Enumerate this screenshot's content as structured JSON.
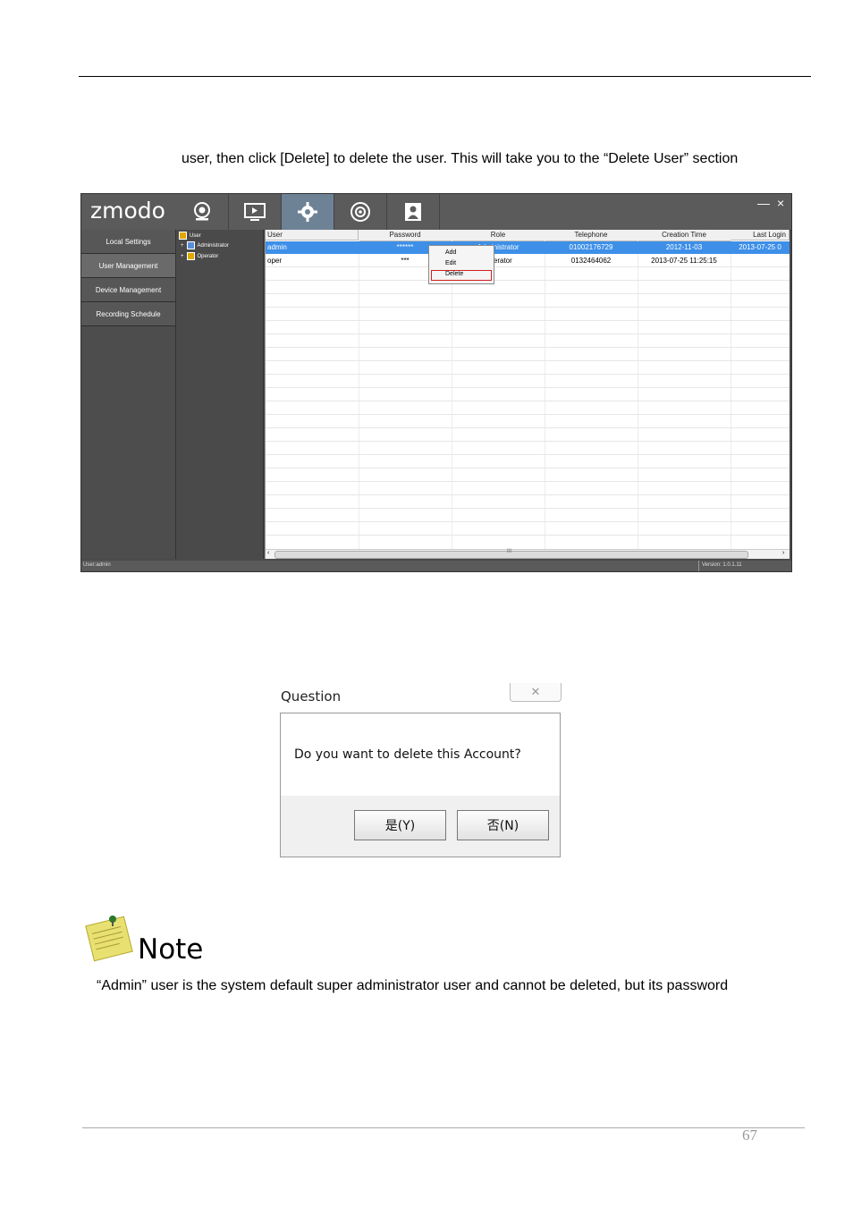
{
  "intro_text": "user, then click [Delete] to delete the user. This will take you to the “Delete User” section",
  "app": {
    "logo": "zmodo",
    "toolbar_icons": [
      "camera-icon",
      "playback-monitor-icon",
      "settings-gear-icon",
      "ptz-icon",
      "user-account-icon"
    ],
    "sidebar_items": [
      {
        "label": "Local Settings"
      },
      {
        "label": "User Management"
      },
      {
        "label": "Device Management"
      },
      {
        "label": "Recording Schedule"
      }
    ],
    "tree": {
      "root": "User",
      "children": [
        "Administrator",
        "Operator"
      ]
    },
    "table": {
      "columns": [
        "User",
        "Password",
        "Role",
        "Telephone",
        "Creation Time",
        "Last Login"
      ],
      "rows": [
        [
          "admin",
          "******",
          "Administrator",
          "01002176729",
          "2012-11-03",
          "2013-07-25 0"
        ],
        [
          "oper",
          "***",
          "Operator",
          "0132464062",
          "2013-07-25 11:25:15",
          ""
        ]
      ]
    },
    "context_menu": [
      "Add",
      "Edit",
      "Delete"
    ],
    "status_left": "User:admin",
    "status_right": "Version: 1.0.1.11",
    "window_controls": {
      "minimize": "—",
      "close": "×"
    },
    "scroll_mark": "III"
  },
  "dialog": {
    "title": "Question",
    "close_glyph": "✕",
    "message": "Do you want to delete this Account?",
    "yes_label": "是(Y)",
    "no_label": "否(N)"
  },
  "note": {
    "title": "Note",
    "text": "“Admin” user is the system default super administrator user and cannot be deleted, but its password"
  },
  "page_number": "67"
}
